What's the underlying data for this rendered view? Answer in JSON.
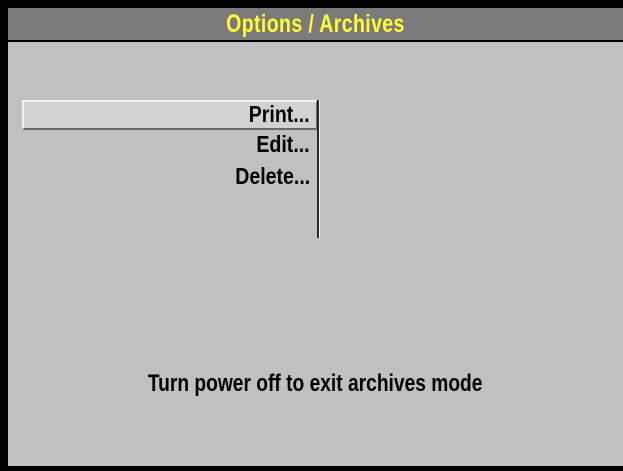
{
  "title_bar": {
    "title": "Options / Archives"
  },
  "menu": {
    "items": [
      {
        "label": "Print..."
      },
      {
        "label": "Edit..."
      },
      {
        "label": "Delete..."
      }
    ],
    "selected_label": "Print..."
  },
  "status": {
    "message": "Turn power off to exit archives mode"
  },
  "colors": {
    "title_text": "#ffff33",
    "title_bar": "#7a7a7a",
    "background": "#c0c0c0",
    "frame": "#000000"
  }
}
